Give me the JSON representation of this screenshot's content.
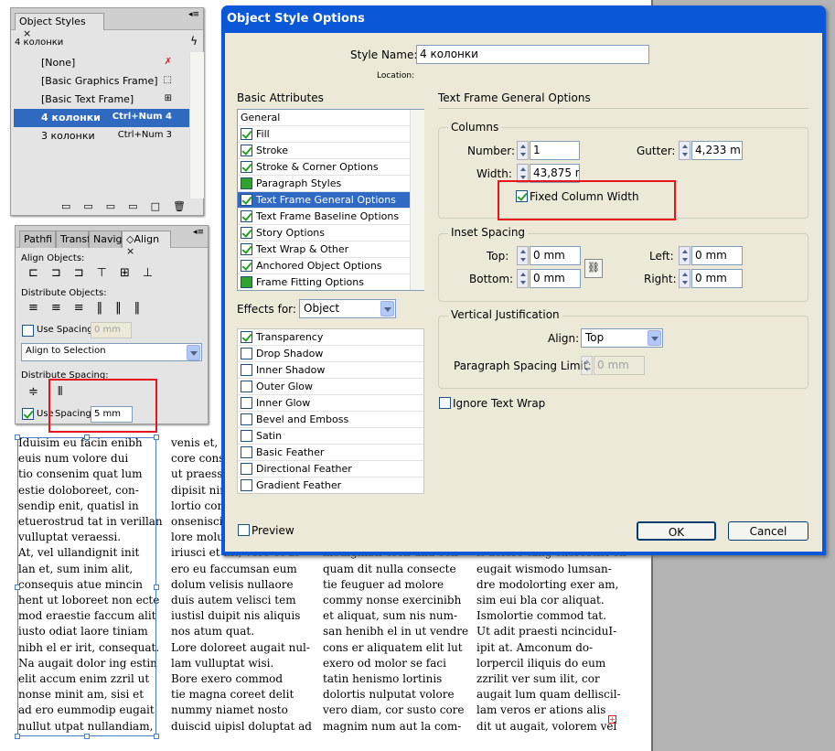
{
  "document": {
    "col1": "Iduisim eu facin enibh\neuis num volore dui\ntio consenim quat lum\nestie doloboreet, con-\nsendip enit, quatisl in\netuerostrud tat in verillan\nvulluptat veraessi.\nAt, vel ullandignit init\nlan et, sum inim alit,\nconsequis atue mincin\nhent ut loboreet non ecte\nmod eraestie faccum alit\niusto odiat laore tiniam\nnibh el er irit, consequat.\nNa augait dolor ing estin\nelit accum enim zzril ut\nnonse minit am, sisi et\nad ero eummodip eugait\nnullut utpat nullandiam,",
    "col2": "venis et, c\ncore cons\nut praesse\ndipisit nir\nlortio core\nonsenisci\nlore molu\niriusci et ilit, vero et at\nero eu faccumsan eum\ndolum velisis nullaore\nduis autem velisci tem\niustisl duipit nis aliquis\nnos atum quat.\nLore doloreet augait nul-\nlam vulluptat wisi.\nBore exero commod\ntie magna coreet delit\nnummy niamet nosto\nduiscid uipisl doluptat ad",
    "col3": "\n\n\n\n\n\n\nmodignibh ercil ulla con\nquam dit nulla consecte\ntie feuguer ad molore\ncommy nonse exercinibh\net aliquat, sum nis num-\nsan henibh el in ut vendre\ncons er aliquatem elit lut\nexero od molor se faci\ntatin henismo lortinis\ndolortis nulputat volore\nvero diam, cor susto core\nmagnim num aut la com-",
    "col4": "\n\n\n\n\n\n\nit dolore tang exerostisi en\neugait wismodo lumsan-\ndre modolorting exer am,\nsim eui bla cor aliquat.\nIsmolortie commod tat.\nUt adit praesti ncinciduI-\nipit at. Amconum do-\nlorpercil iliquis do eum\nzzrilit ver sum ilit, cor\naugait lum quam delliscil-\nlam veros er ations alis\ndit ut augait, volorem vel"
  },
  "object_styles_panel": {
    "tab": "Object Styles",
    "current": "4 колонки",
    "items": [
      {
        "name": "[None]",
        "shortcut": ""
      },
      {
        "name": "[Basic Graphics Frame]",
        "shortcut": ""
      },
      {
        "name": "[Basic Text Frame]",
        "shortcut": ""
      },
      {
        "name": "4 колонки",
        "shortcut": "Ctrl+Num 4"
      },
      {
        "name": "3 колонки",
        "shortcut": "Ctrl+Num 3"
      }
    ]
  },
  "align_panel": {
    "tabs": [
      "Pathfi",
      "Transf",
      "Navig",
      "Align"
    ],
    "align_objects": "Align Objects:",
    "distribute_objects": "Distribute Objects:",
    "use_spacing": "Use Spacing",
    "spacing_value": "0 mm",
    "align_to": "Align to Selection",
    "distribute_spacing": "Distribute Spacing:",
    "use_spacing2": "Use",
    "spacing2_label": "Spacing",
    "spacing2_value": "5 mm"
  },
  "dialog": {
    "title": "Object Style Options",
    "style_name_label": "Style Name:",
    "style_name": "4 колонки",
    "location_label": "Location:",
    "basic_attributes_label": "Basic Attributes",
    "basic_attributes": [
      "General",
      "Fill",
      "Stroke",
      "Stroke & Corner Options",
      "Paragraph Styles",
      "Text Frame General Options",
      "Text Frame Baseline Options",
      "Story Options",
      "Text Wrap & Other",
      "Anchored Object Options",
      "Frame Fitting Options"
    ],
    "effects_for_label": "Effects for:",
    "effects_for": "Object",
    "effects": [
      "Transparency",
      "Drop Shadow",
      "Inner Shadow",
      "Outer Glow",
      "Inner Glow",
      "Bevel and Emboss",
      "Satin",
      "Basic Feather",
      "Directional Feather",
      "Gradient Feather"
    ],
    "section_title": "Text Frame General Options",
    "columns": {
      "label": "Columns",
      "number_label": "Number:",
      "number": "1",
      "gutter_label": "Gutter:",
      "gutter": "4,233 mr",
      "width_label": "Width:",
      "width": "43,875 n",
      "fixed_width": "Fixed Column Width"
    },
    "inset": {
      "label": "Inset Spacing",
      "top_label": "Top:",
      "top": "0 mm",
      "bottom_label": "Bottom:",
      "bottom": "0 mm",
      "left_label": "Left:",
      "left": "0 mm",
      "right_label": "Right:",
      "right": "0 mm"
    },
    "vertical": {
      "label": "Vertical Justification",
      "align_label": "Align:",
      "align": "Top",
      "psl_label": "Paragraph Spacing Limit:",
      "psl": "0 mm"
    },
    "ignore_wrap": "Ignore Text Wrap",
    "preview": "Preview",
    "ok": "OK",
    "cancel": "Cancel"
  },
  "colors": {
    "dialog_blue": "#0a57d8",
    "selection": "#316ac5",
    "highlight_red": "#e8141c"
  }
}
